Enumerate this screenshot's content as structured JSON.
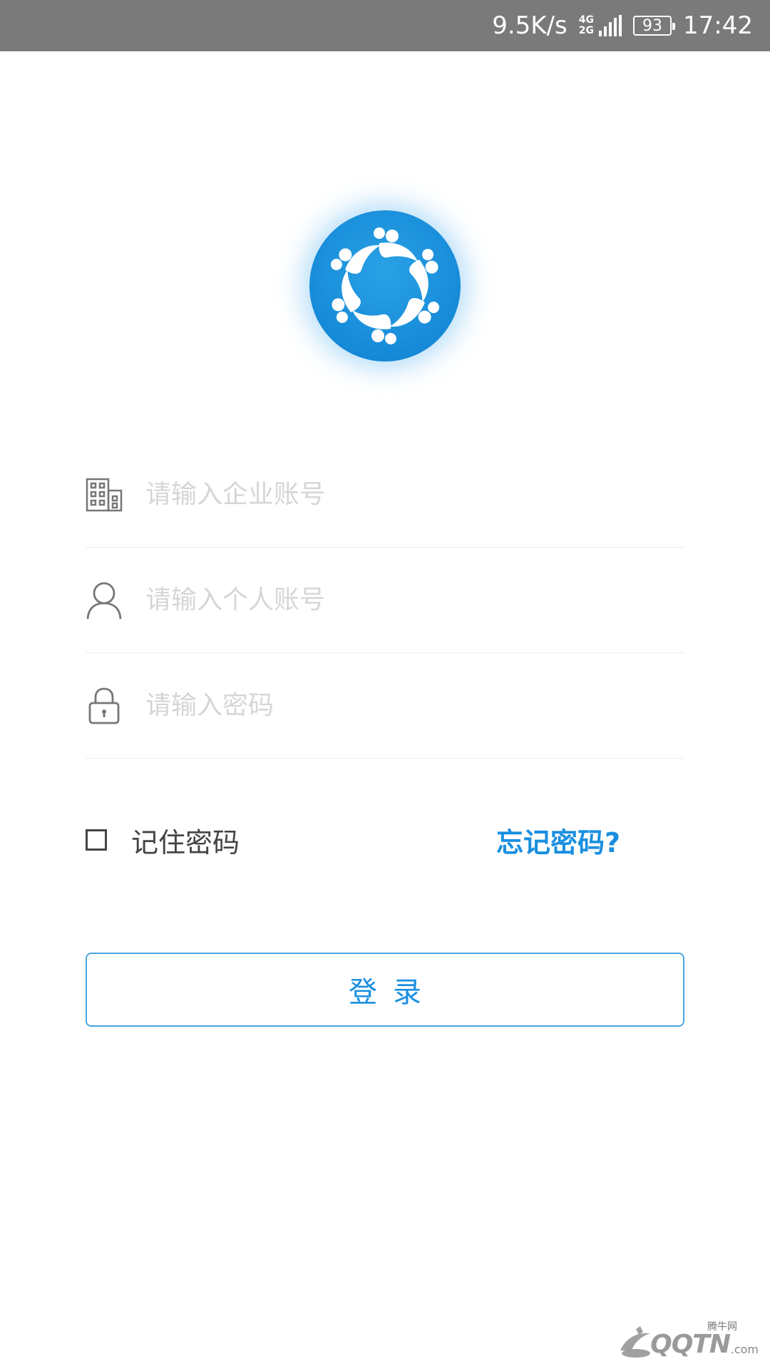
{
  "status_bar": {
    "net_speed": "9.5K/s",
    "net_type_top": "4G",
    "net_type_bottom": "2G",
    "battery": "93",
    "time": "17:42"
  },
  "logo": {
    "icon": "people-star-logo",
    "color": "#1a8fe0"
  },
  "form": {
    "company_account": {
      "icon": "building-icon",
      "placeholder": "请输入企业账号"
    },
    "personal_account": {
      "icon": "person-icon",
      "placeholder": "请输入个人账号"
    },
    "password": {
      "icon": "lock-icon",
      "placeholder": "请输入密码"
    }
  },
  "options": {
    "remember_label": "记住密码",
    "remember_checked": false,
    "forgot_label": "忘记密码?"
  },
  "login_button": {
    "label": "登录"
  },
  "watermark": {
    "cn_label": "腾牛网",
    "text": "QQTN",
    "suffix": ".com"
  },
  "colors": {
    "accent": "#1a8fe0",
    "status_bar": "#7a7a7a",
    "placeholder": "#d6d6d6"
  }
}
